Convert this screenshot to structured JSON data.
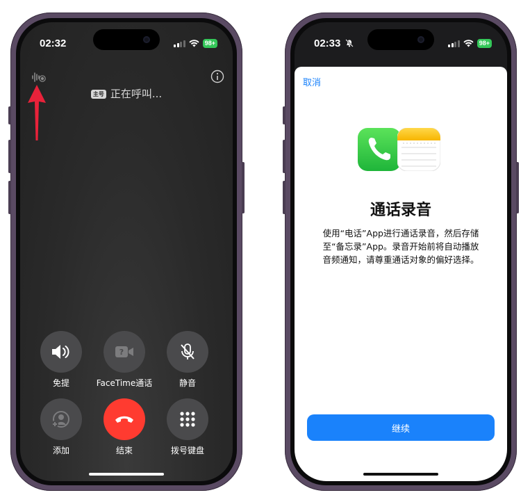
{
  "left_phone": {
    "status": {
      "time": "02:32",
      "battery": "98+"
    },
    "caller": {
      "sim_badge": "主号",
      "status_text": "正在呼叫..."
    },
    "buttons": [
      {
        "label": "免提",
        "icon": "speaker-icon"
      },
      {
        "label": "FaceTime通话",
        "icon": "facetime-icon"
      },
      {
        "label": "静音",
        "icon": "mute-icon"
      },
      {
        "label": "添加",
        "icon": "add-call-icon"
      },
      {
        "label": "结束",
        "icon": "end-call-icon"
      },
      {
        "label": "拨号键盘",
        "icon": "keypad-icon"
      }
    ],
    "colors": {
      "arrow": "#e8223a",
      "end_button": "#ff3b30"
    }
  },
  "right_phone": {
    "status": {
      "time": "02:33",
      "battery": "98+"
    },
    "cancel_label": "取消",
    "title": "通话录音",
    "body_lines": [
      "使用“电话”App进行通话录音，然后存储",
      "至“备忘录”App。录音开始前将自动播放",
      "音频通知，请尊重通话对象的偏好选择。"
    ],
    "continue_label": "继续",
    "colors": {
      "accent": "#1a82fb"
    }
  }
}
